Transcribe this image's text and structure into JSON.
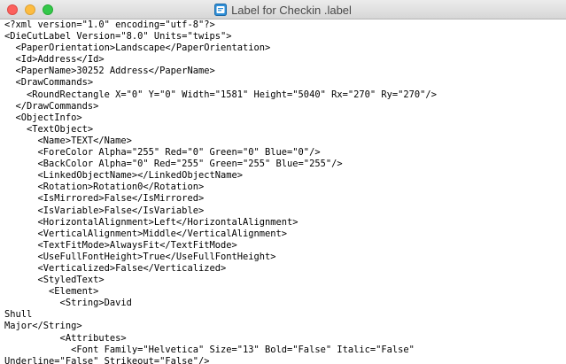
{
  "window": {
    "title": "Label for Checkin .label",
    "icon": "label-document-icon"
  },
  "editor": {
    "lines": [
      "<?xml version=\"1.0\" encoding=\"utf-8\"?>",
      "<DieCutLabel Version=\"8.0\" Units=\"twips\">",
      "  <PaperOrientation>Landscape</PaperOrientation>",
      "  <Id>Address</Id>",
      "  <PaperName>30252 Address</PaperName>",
      "  <DrawCommands>",
      "    <RoundRectangle X=\"0\" Y=\"0\" Width=\"1581\" Height=\"5040\" Rx=\"270\" Ry=\"270\"/>",
      "  </DrawCommands>",
      "  <ObjectInfo>",
      "    <TextObject>",
      "      <Name>TEXT</Name>",
      "      <ForeColor Alpha=\"255\" Red=\"0\" Green=\"0\" Blue=\"0\"/>",
      "      <BackColor Alpha=\"0\" Red=\"255\" Green=\"255\" Blue=\"255\"/>",
      "      <LinkedObjectName></LinkedObjectName>",
      "      <Rotation>Rotation0</Rotation>",
      "      <IsMirrored>False</IsMirrored>",
      "      <IsVariable>False</IsVariable>",
      "      <HorizontalAlignment>Left</HorizontalAlignment>",
      "      <VerticalAlignment>Middle</VerticalAlignment>",
      "      <TextFitMode>AlwaysFit</TextFitMode>",
      "      <UseFullFontHeight>True</UseFullFontHeight>",
      "      <Verticalized>False</Verticalized>",
      "      <StyledText>",
      "        <Element>",
      "          <String>David",
      "Shull",
      "Major</String>",
      "          <Attributes>",
      "            <Font Family=\"Helvetica\" Size=\"13\" Bold=\"False\" Italic=\"False\"",
      "Underline=\"False\" Strikeout=\"False\"/>"
    ]
  }
}
